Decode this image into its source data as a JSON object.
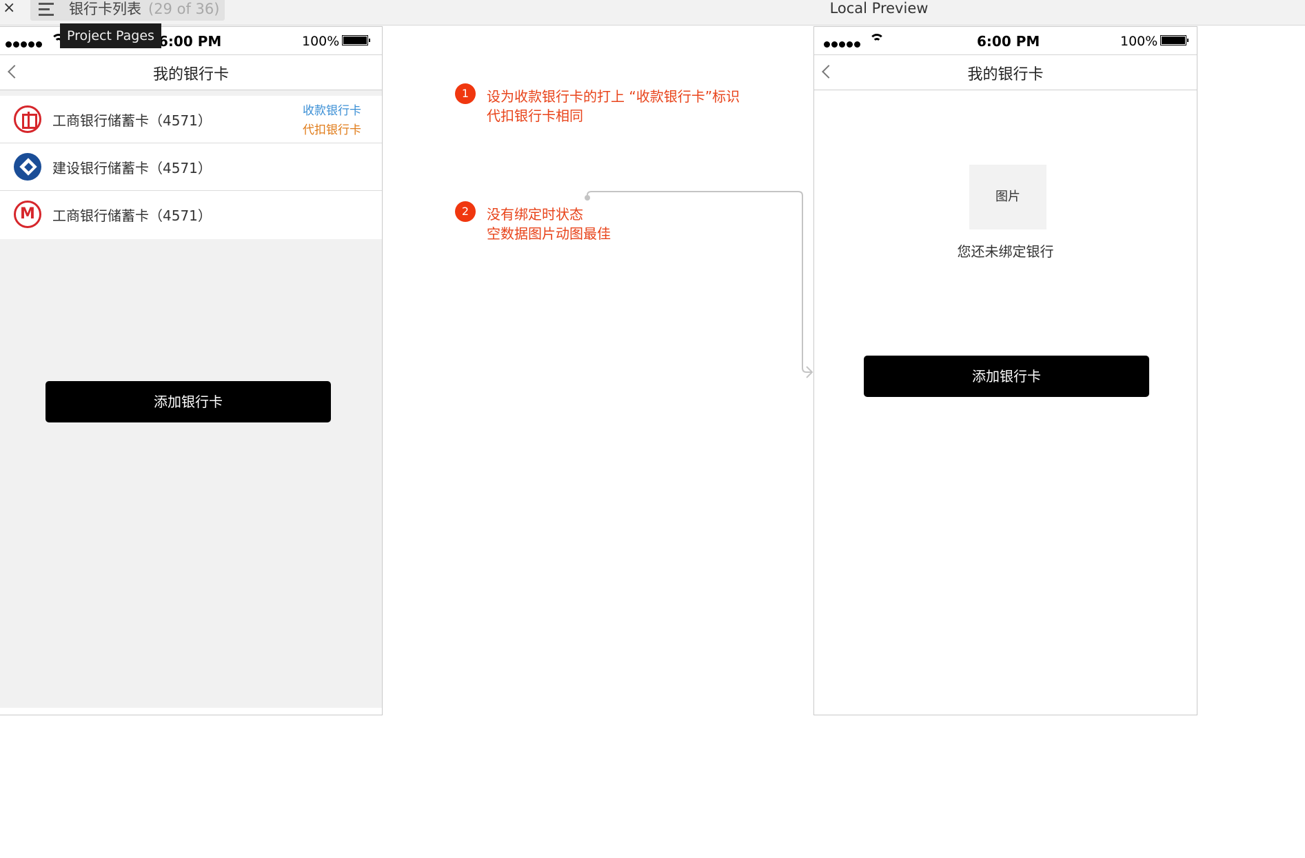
{
  "topbar": {
    "close_icon": "×",
    "page_title": "银行卡列表",
    "page_count": "(29 of 36)",
    "local_preview": "Local Preview",
    "tooltip": "Project Pages"
  },
  "phone_status": {
    "time": "6:00 PM",
    "battery": "100%"
  },
  "left_phone": {
    "nav_title": "我的银行卡",
    "cards": [
      {
        "bank": "icbc",
        "name": "工商银行储蓄卡（4571）",
        "tag_receive": "收款银行卡",
        "tag_debit": "代扣银行卡"
      },
      {
        "bank": "ccb",
        "name": "建设银行储蓄卡（4571）"
      },
      {
        "bank": "cmb",
        "name": "工商银行储蓄卡（4571）"
      }
    ],
    "add_button": "添加银行卡"
  },
  "right_phone": {
    "nav_title": "我的银行卡",
    "image_placeholder": "图片",
    "empty_text": "您还未绑定银行",
    "add_button": "添加银行卡"
  },
  "annotations": [
    {
      "number": "1",
      "line1": "设为收款银行卡的打上 “收款银行卡”标识",
      "line2": "代扣银行卡相同"
    },
    {
      "number": "2",
      "line1": "没有绑定时状态",
      "line2": "空数据图片动图最佳"
    }
  ],
  "colors": {
    "accent_blue": "#3b8fd5",
    "accent_orange": "#e07b18",
    "annotation_red": "#e8431a",
    "button_black": "#000000"
  }
}
